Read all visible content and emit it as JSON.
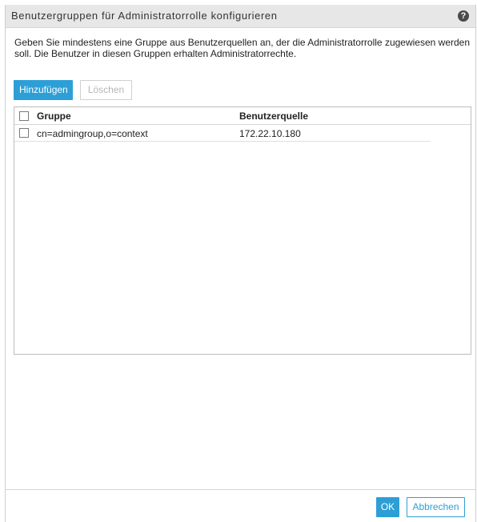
{
  "dialog": {
    "title": "Benutzergruppen für Administratorrolle konfigurieren",
    "help_icon": "?",
    "description": "Geben Sie mindestens eine Gruppe aus Benutzerquellen an, der die Administratorrolle zugewiesen werden soll. Die Benutzer in diesen Gruppen erhalten Administratorrechte."
  },
  "toolbar": {
    "add_label": "Hinzufügen",
    "delete_label": "Löschen"
  },
  "table": {
    "columns": [
      "Gruppe",
      "Benutzerquelle"
    ],
    "rows": [
      {
        "group": "cn=admingroup,o=context",
        "source": "172.22.10.180"
      }
    ]
  },
  "footer": {
    "ok_label": "OK",
    "cancel_label": "Abbrechen"
  },
  "colors": {
    "accent": "#2d9fd6",
    "titlebar": "#e7e7e7"
  }
}
